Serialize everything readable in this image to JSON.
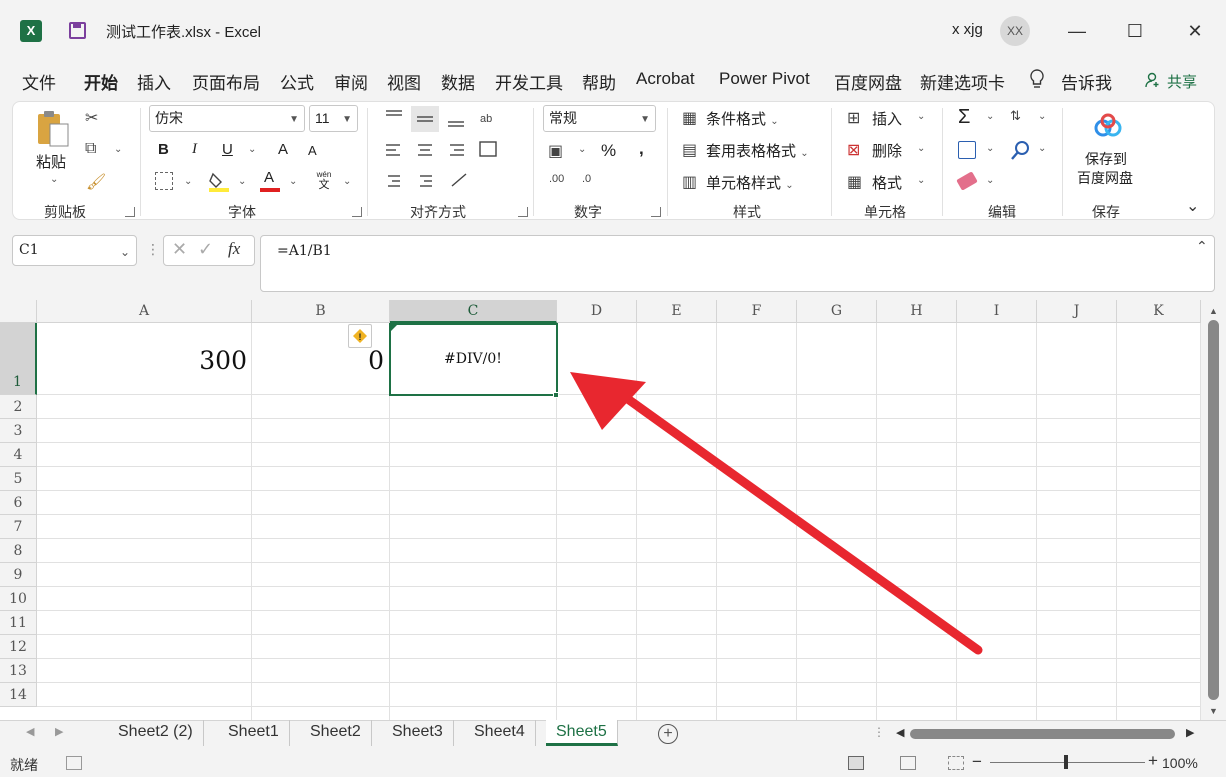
{
  "window": {
    "logo": "X",
    "title": "测试工作表.xlsx  -  Excel",
    "user": "x xjg",
    "avatar": "XX",
    "controls": {
      "minimize": "—",
      "maximize": "☐",
      "close": "✕"
    }
  },
  "menu": {
    "items": [
      "文件",
      "开始",
      "插入",
      "页面布局",
      "公式",
      "审阅",
      "视图",
      "数据",
      "开发工具",
      "帮助",
      "Acrobat",
      "Power Pivot",
      "百度网盘",
      "新建选项卡"
    ],
    "active": "开始",
    "tell_me": "告诉我",
    "share": "共享"
  },
  "ribbon": {
    "clipboard": {
      "label": "剪贴板",
      "paste": "粘贴"
    },
    "font": {
      "label": "字体",
      "name": "仿宋",
      "size": "11",
      "bold": "B",
      "italic": "I",
      "underline": "U",
      "grow": "A",
      "shrink": "A",
      "font_color": "A",
      "phonetic_top": "wén",
      "phonetic_bottom": "文"
    },
    "alignment": {
      "label": "对齐方式"
    },
    "number": {
      "label": "数字",
      "format": "常规",
      "percent": "%",
      "comma": ","
    },
    "styles": {
      "label": "样式",
      "conditional": "条件格式",
      "table": "套用表格格式",
      "cell": "单元格样式"
    },
    "cells": {
      "label": "单元格",
      "insert": "插入",
      "delete": "删除",
      "format": "格式"
    },
    "editing": {
      "label": "编辑",
      "sum": "Σ"
    },
    "save": {
      "label": "保存",
      "button_line1": "保存到",
      "button_line2": "百度网盘"
    }
  },
  "formula_bar": {
    "name_box": "C1",
    "formula": "=A1/B1",
    "fx": "fx"
  },
  "sheet": {
    "columns": [
      "A",
      "B",
      "C",
      "D",
      "E",
      "F",
      "G",
      "H",
      "I",
      "J",
      "K"
    ],
    "rows": [
      "1",
      "2",
      "3",
      "4",
      "5",
      "6",
      "7",
      "8",
      "9",
      "10",
      "11",
      "12",
      "13",
      "14"
    ],
    "cells": {
      "A1": "300",
      "B1": "0",
      "C1": "#DIV/0!"
    },
    "selected_column": "C",
    "warning_icon": "!"
  },
  "tabs": {
    "items": [
      "Sheet2 (2)",
      "Sheet1",
      "Sheet2",
      "Sheet3",
      "Sheet4",
      "Sheet5"
    ],
    "active": "Sheet5",
    "add": "+"
  },
  "status": {
    "mode": "就绪",
    "zoom": "100%"
  },
  "colors": {
    "accent": "#1e7145",
    "arrow": "#e8272f"
  }
}
